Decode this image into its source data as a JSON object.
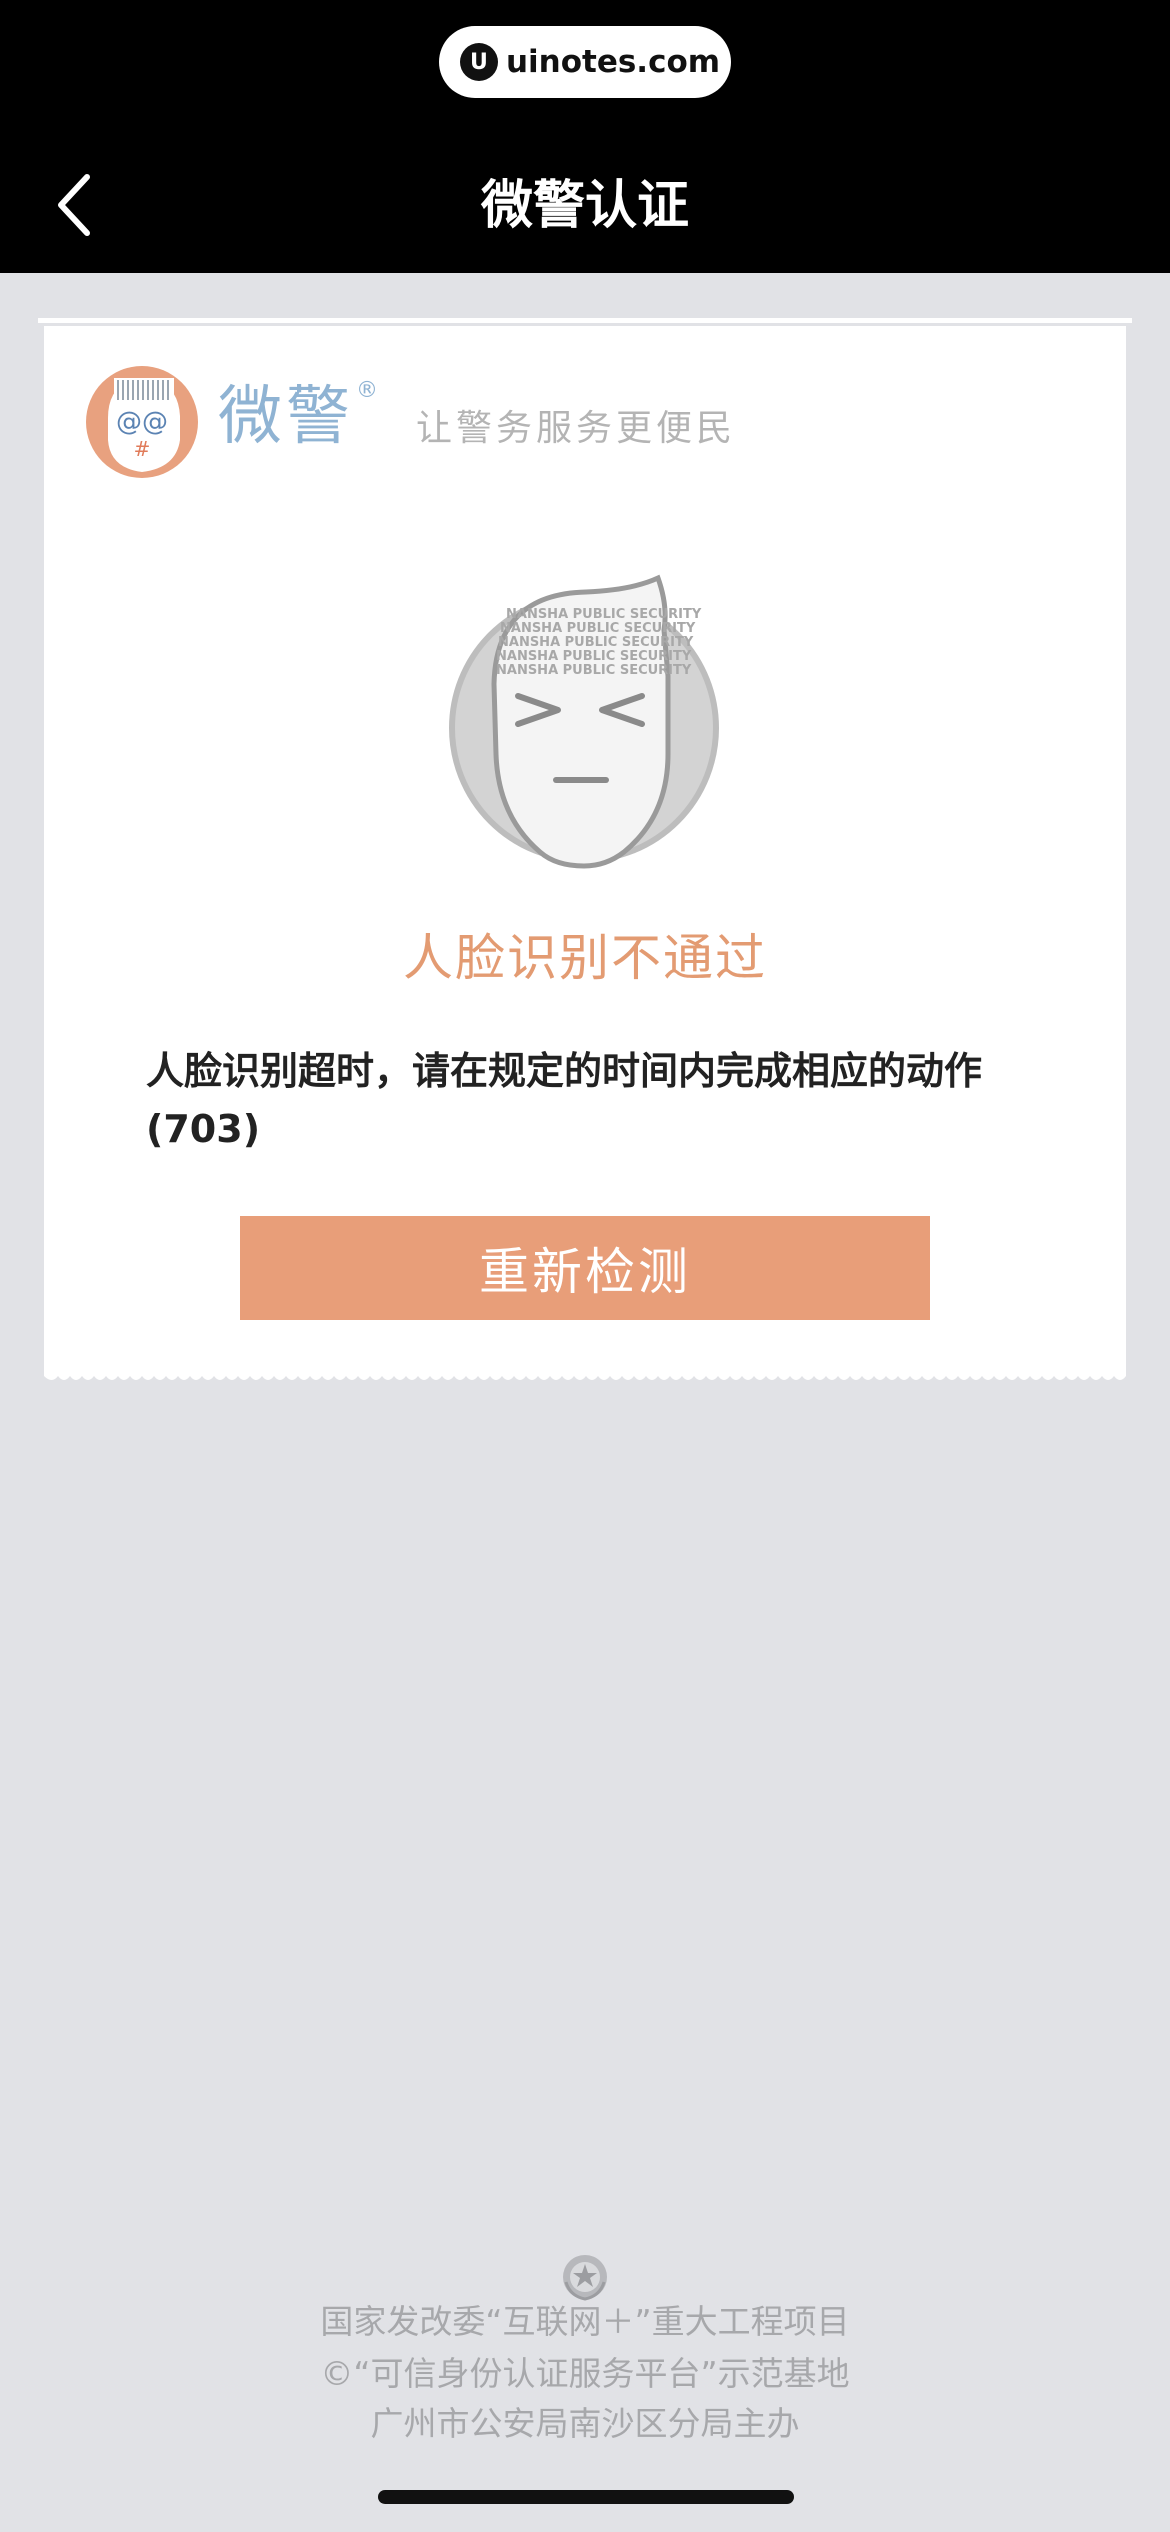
{
  "watermark": {
    "logo_letter": "U",
    "text": "uinotes.com"
  },
  "nav": {
    "title": "微警认证",
    "back_icon": "chevron-left-icon"
  },
  "brand": {
    "logo_icon": "weijing-mascot-logo",
    "name": "微警",
    "registered": "®",
    "slogan": "让警务服务更便民"
  },
  "result": {
    "illustration": "face-failed-illustration",
    "title": "人脸识别不通过",
    "message_line1": "人脸识别超时，请在规定的时间内完成相应的动作",
    "message_line2": "(703)",
    "retry_label": "重新检测"
  },
  "footer": {
    "emblem_icon": "police-emblem-icon",
    "line1": "国家发改委“互联网＋”重大工程项目",
    "line2": "©“可信身份认证服务平台”示范基地",
    "line3": "广州市公安局南沙区分局主办"
  },
  "colors": {
    "accent": "#e89e79",
    "title_orange": "#e39b72",
    "brand_blue": "#8fb3d3",
    "background": "#e1e2e6",
    "nav_background": "#000000"
  }
}
